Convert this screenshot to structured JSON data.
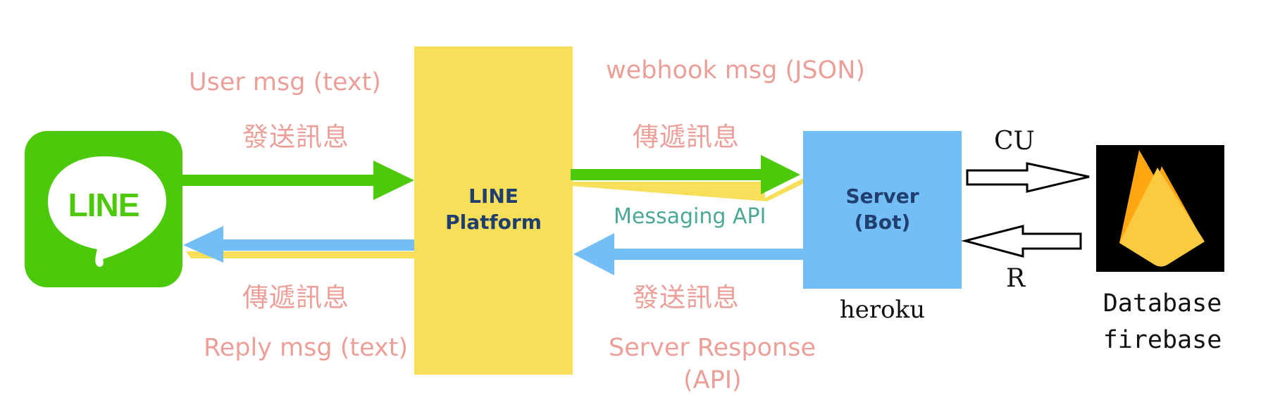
{
  "line_app": {
    "logo_text": "LINE",
    "color": "#4cc90a"
  },
  "line_platform": {
    "line1": "LINE",
    "line2": "Platform",
    "color": "#f7df5a"
  },
  "server": {
    "line1": "Server",
    "line2": "(Bot)",
    "host": "heroku",
    "color": "#74bef7"
  },
  "database": {
    "line1": "Database",
    "line2": "firebase"
  },
  "labels": {
    "user_msg": "User msg (text)",
    "send_msg_top": "發送訊息",
    "webhook_msg": "webhook msg (JSON)",
    "pass_msg_top": "傳遞訊息",
    "messaging_api": "Messaging API",
    "pass_msg_bottom": "傳遞訊息",
    "reply_msg": "Reply msg (text)",
    "send_msg_bottom": "發送訊息",
    "server_response": "Server Response",
    "server_response_api": "(API)",
    "cu": "CU",
    "r": "R"
  },
  "colors": {
    "green_arrow": "#4cc90a",
    "blue_arrow": "#74bef7",
    "yellow_shadow": "#f7df5a",
    "label_pink": "#ec9f98",
    "label_teal": "#4ba897"
  }
}
